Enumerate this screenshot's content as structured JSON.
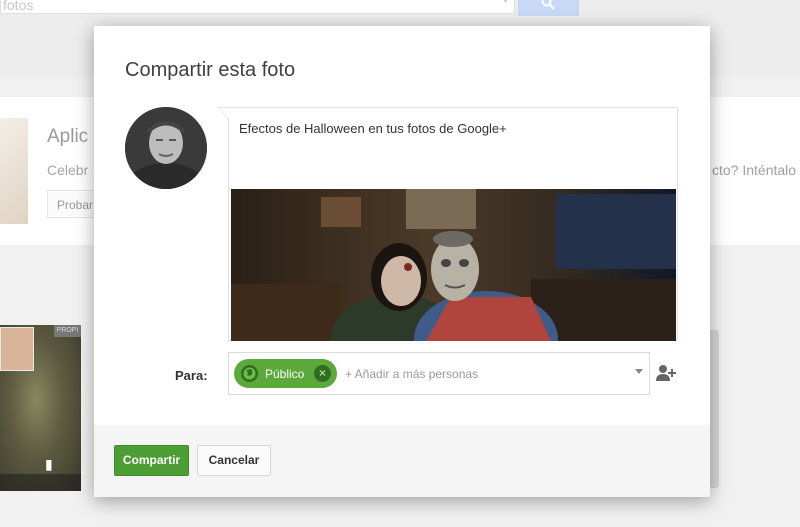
{
  "background": {
    "search": {
      "value": "fotos"
    },
    "card": {
      "title": "Aplic",
      "description": "Celebr",
      "button_label": "Probar",
      "right_text": "cto? Inténtalo"
    },
    "photo_tag": "PROPI"
  },
  "dialog": {
    "title": "Compartir esta foto",
    "post_text": "Efectos de Halloween en tus fotos de Google+",
    "to_label": "Para:",
    "chip_label": "Público",
    "add_placeholder": "+ Añadir a más personas",
    "share_button": "Compartir",
    "cancel_button": "Cancelar"
  },
  "colors": {
    "share_green": "#4c9d34",
    "chip_green": "#5aa93a",
    "search_blue": "#c7d9f5"
  },
  "icons": {
    "search": "search-icon",
    "chevron": "chevron-down-icon",
    "globe": "globe-icon",
    "remove": "close-icon",
    "add_person": "add-person-icon"
  }
}
